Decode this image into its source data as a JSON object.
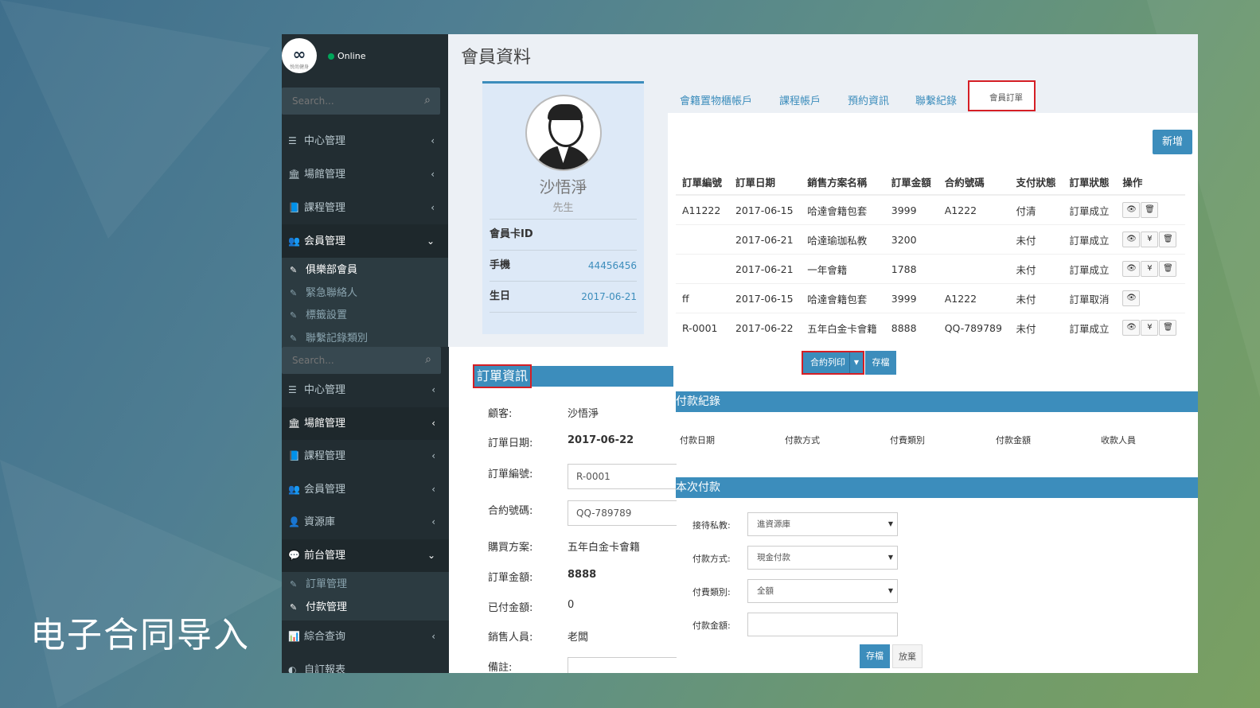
{
  "slide": {
    "title": "电子合同导入"
  },
  "top": {
    "status": "Online",
    "logo_text": "∞",
    "logo_sub": "悦尚健身",
    "search_placeholder": "Search...",
    "menu": [
      {
        "icon": "☰",
        "label": "中心管理",
        "chev": "‹"
      },
      {
        "icon": "🏛",
        "label": "場館管理",
        "chev": "‹"
      },
      {
        "icon": "📘",
        "label": "課程管理",
        "chev": "‹"
      },
      {
        "icon": "👥",
        "label": "会員管理",
        "chev": "⌄"
      }
    ],
    "submenu": [
      {
        "label": "俱樂部會員"
      },
      {
        "label": "緊急聯絡人"
      },
      {
        "label": "標籤設置"
      },
      {
        "label": "聯繫記錄類別"
      }
    ],
    "page_title": "會員資料",
    "profile": {
      "name": "沙悟淨",
      "title": "先生",
      "card_label": "會員卡ID",
      "phone_label": "手機",
      "phone": "44456456",
      "birthday_label": "生日",
      "birthday": "2017-06-21"
    },
    "tabs": [
      "會籍置物櫃帳戶",
      "課程帳戶",
      "預約資訊",
      "聯繫紀錄",
      "會員訂單"
    ],
    "add_button": "新增",
    "table": {
      "headers": [
        "訂單編號",
        "訂單日期",
        "銷售方案名稱",
        "訂單金額",
        "合約號碼",
        "支付狀態",
        "訂單狀態",
        "操作"
      ],
      "rows": [
        {
          "id": "A11222",
          "date": "2017-06-15",
          "plan": "哈達會籍包套",
          "amount": "3999",
          "contract": "A1222",
          "pay": "付清",
          "status": "訂單成立",
          "ops": [
            "👁",
            "🗑"
          ]
        },
        {
          "id": "",
          "date": "2017-06-21",
          "plan": "哈達瑜珈私教",
          "amount": "3200",
          "contract": "",
          "pay": "未付",
          "status": "訂單成立",
          "ops": [
            "👁",
            "¥",
            "🗑"
          ]
        },
        {
          "id": "",
          "date": "2017-06-21",
          "plan": "一年會籍",
          "amount": "1788",
          "contract": "",
          "pay": "未付",
          "status": "訂單成立",
          "ops": [
            "👁",
            "¥",
            "🗑"
          ]
        },
        {
          "id": "ff",
          "date": "2017-06-15",
          "plan": "哈達會籍包套",
          "amount": "3999",
          "contract": "A1222",
          "pay": "未付",
          "status": "訂單取消",
          "ops": [
            "👁"
          ]
        },
        {
          "id": "R-0001",
          "date": "2017-06-22",
          "plan": "五年白金卡會籍",
          "amount": "8888",
          "contract": "QQ-789789",
          "pay": "未付",
          "status": "訂單成立",
          "ops": [
            "👁",
            "¥",
            "🗑"
          ]
        }
      ]
    }
  },
  "bottom": {
    "search_placeholder": "Search...",
    "menu": [
      {
        "icon": "☰",
        "label": "中心管理",
        "chev": "‹"
      },
      {
        "icon": "🏛",
        "label": "場館管理",
        "chev": "‹"
      },
      {
        "icon": "📘",
        "label": "課程管理",
        "chev": "‹"
      },
      {
        "icon": "👥",
        "label": "会員管理",
        "chev": "‹"
      },
      {
        "icon": "👤",
        "label": "資源庫",
        "chev": "‹"
      },
      {
        "icon": "💬",
        "label": "前台管理",
        "chev": "⌄"
      }
    ],
    "submenu": [
      {
        "label": "訂單管理"
      },
      {
        "label": "付款管理"
      }
    ],
    "menu_after": [
      {
        "icon": "📊",
        "label": "綜合查询",
        "chev": "‹"
      },
      {
        "icon": "◐",
        "label": "自訂報表",
        "chev": ""
      }
    ],
    "order_info_title": "訂單資訊",
    "order": [
      {
        "label": "顧客:",
        "value": "沙悟淨"
      },
      {
        "label": "訂單日期:",
        "value": "2017-06-22"
      },
      {
        "label": "訂單編號:",
        "value": "R-0001"
      },
      {
        "label": "合約號碼:",
        "value": "QQ-789789"
      },
      {
        "label": "購買方案:",
        "value": "五年白金卡會籍"
      },
      {
        "label": "訂單金額:",
        "value": "8888"
      },
      {
        "label": "已付金額:",
        "value": "0"
      },
      {
        "label": "銷售人員:",
        "value": "老闆"
      },
      {
        "label": "備註:",
        "value": ""
      }
    ],
    "print_button": "合約列印",
    "save_button": "存檔",
    "payment_record_title": "付款紀錄",
    "payment_headers": [
      "付款日期",
      "付款方式",
      "付費類別",
      "付款金額",
      "收款人員"
    ],
    "this_payment_title": "本次付款",
    "payment_form": [
      {
        "label": "接待私教:",
        "value": "進資源庫"
      },
      {
        "label": "付款方式:",
        "value": "現金付款"
      },
      {
        "label": "付費類別:",
        "value": "全額"
      },
      {
        "label": "付款金額:",
        "value": ""
      }
    ],
    "save2": "存檔",
    "cancel": "放棄"
  },
  "colors": {
    "primary": "#3c8dbc",
    "sidebar": "#222d32",
    "highlight": "#d51f25"
  }
}
